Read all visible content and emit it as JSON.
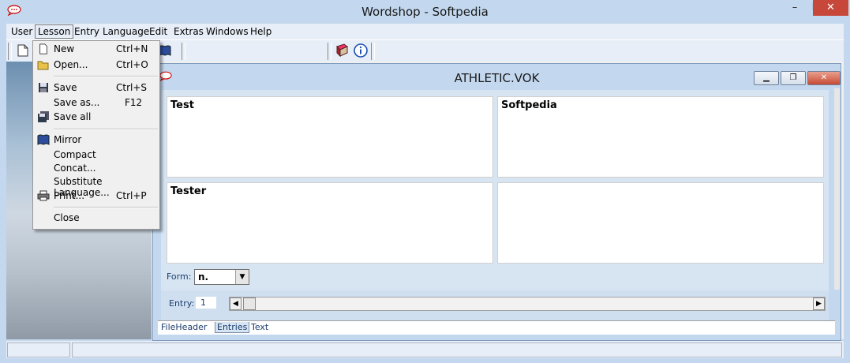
{
  "app": {
    "title": "Wordshop - Softpedia",
    "icon": "speech-bubble-icon",
    "window_controls": [
      "–",
      "☐",
      "✕"
    ]
  },
  "menubar": {
    "items": [
      "User",
      "Lesson",
      "Entry",
      "Language",
      "Edit",
      "Extras",
      "Windows",
      "Help"
    ],
    "active": "Lesson"
  },
  "lesson_menu": {
    "items": [
      {
        "label": "New",
        "shortcut": "Ctrl+N",
        "icon": "new-file-icon"
      },
      {
        "label": "Open...",
        "shortcut": "Ctrl+O",
        "icon": "open-folder-icon"
      },
      {
        "label": "Save",
        "shortcut": "Ctrl+S",
        "icon": "floppy-icon"
      },
      {
        "label": "Save as...",
        "shortcut": "F12",
        "icon": ""
      },
      {
        "label": "Save all",
        "shortcut": "",
        "icon": "save-all-icon"
      },
      {
        "label": "Mirror",
        "shortcut": "",
        "icon": "book-icon"
      },
      {
        "label": "Compact",
        "shortcut": "",
        "icon": ""
      },
      {
        "label": "Concat...",
        "shortcut": "",
        "icon": ""
      },
      {
        "label": "Substitute Language...",
        "shortcut": "",
        "icon": ""
      },
      {
        "label": "Print...",
        "shortcut": "Ctrl+P",
        "icon": "printer-icon"
      },
      {
        "label": "Close",
        "shortcut": "",
        "icon": ""
      }
    ]
  },
  "child_window": {
    "title": "ATHLETIC.VOK",
    "panes": {
      "top_left": "Test",
      "top_right": "Softpedia",
      "bottom_left": "Tester",
      "bottom_right": ""
    },
    "form_label": "Form:",
    "form_value": "n.",
    "entry_label": "Entry:",
    "entry_value": "1",
    "tabs": [
      "FileHeader",
      "Entries",
      "Text"
    ],
    "active_tab": "Entries"
  },
  "colors": {
    "frame": "#c3d8ef",
    "menu_bg": "#e8eef7",
    "client_bg": "#d7e5f3",
    "label_text": "#1b3d6e"
  }
}
